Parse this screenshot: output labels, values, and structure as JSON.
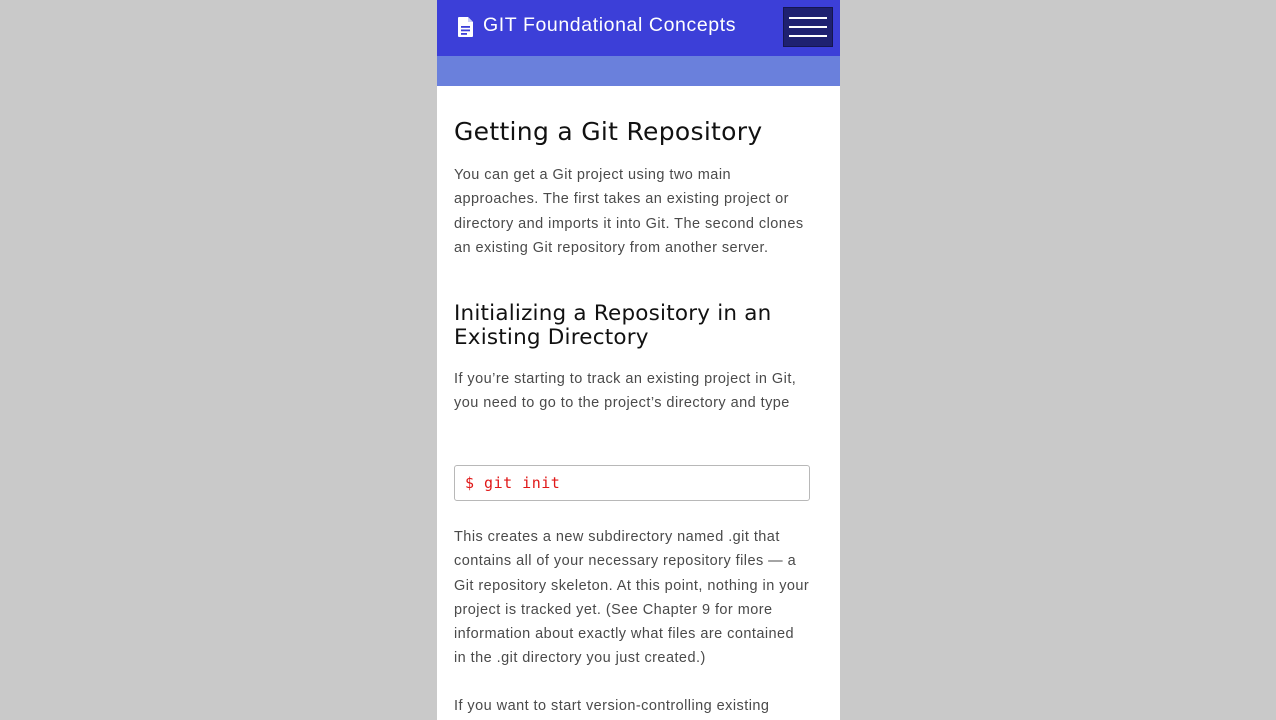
{
  "app": {
    "title": "GIT Foundational Concepts",
    "icon": "document-icon",
    "menu_icon": "hamburger-menu-icon"
  },
  "colors": {
    "topbar": "#3c3fd8",
    "subbar": "#6a80dc",
    "menu_button": "#1f2170",
    "code_text": "#e01818"
  },
  "content": {
    "heading": "Getting a Git Repository",
    "intro": "You can get a Git project using two main approaches. The first takes an existing project or directory and imports it into Git. The second clones an existing Git repository from another server.",
    "subheading": "Initializing a Repository in an Existing Directory",
    "init_para": "If you’re starting to track an existing project in Git, you need to go to the project’s directory and type",
    "code": "$ git init",
    "after_code": "This creates a new subdirectory named .git that contains all of your necessary repository files — a Git repository skeleton. At this point, nothing in your project is tracked yet. (See Chapter 9 for more information about exactly what files are contained in the .git directory you just created.)",
    "next_para": "If you want to start version-controlling existing"
  }
}
